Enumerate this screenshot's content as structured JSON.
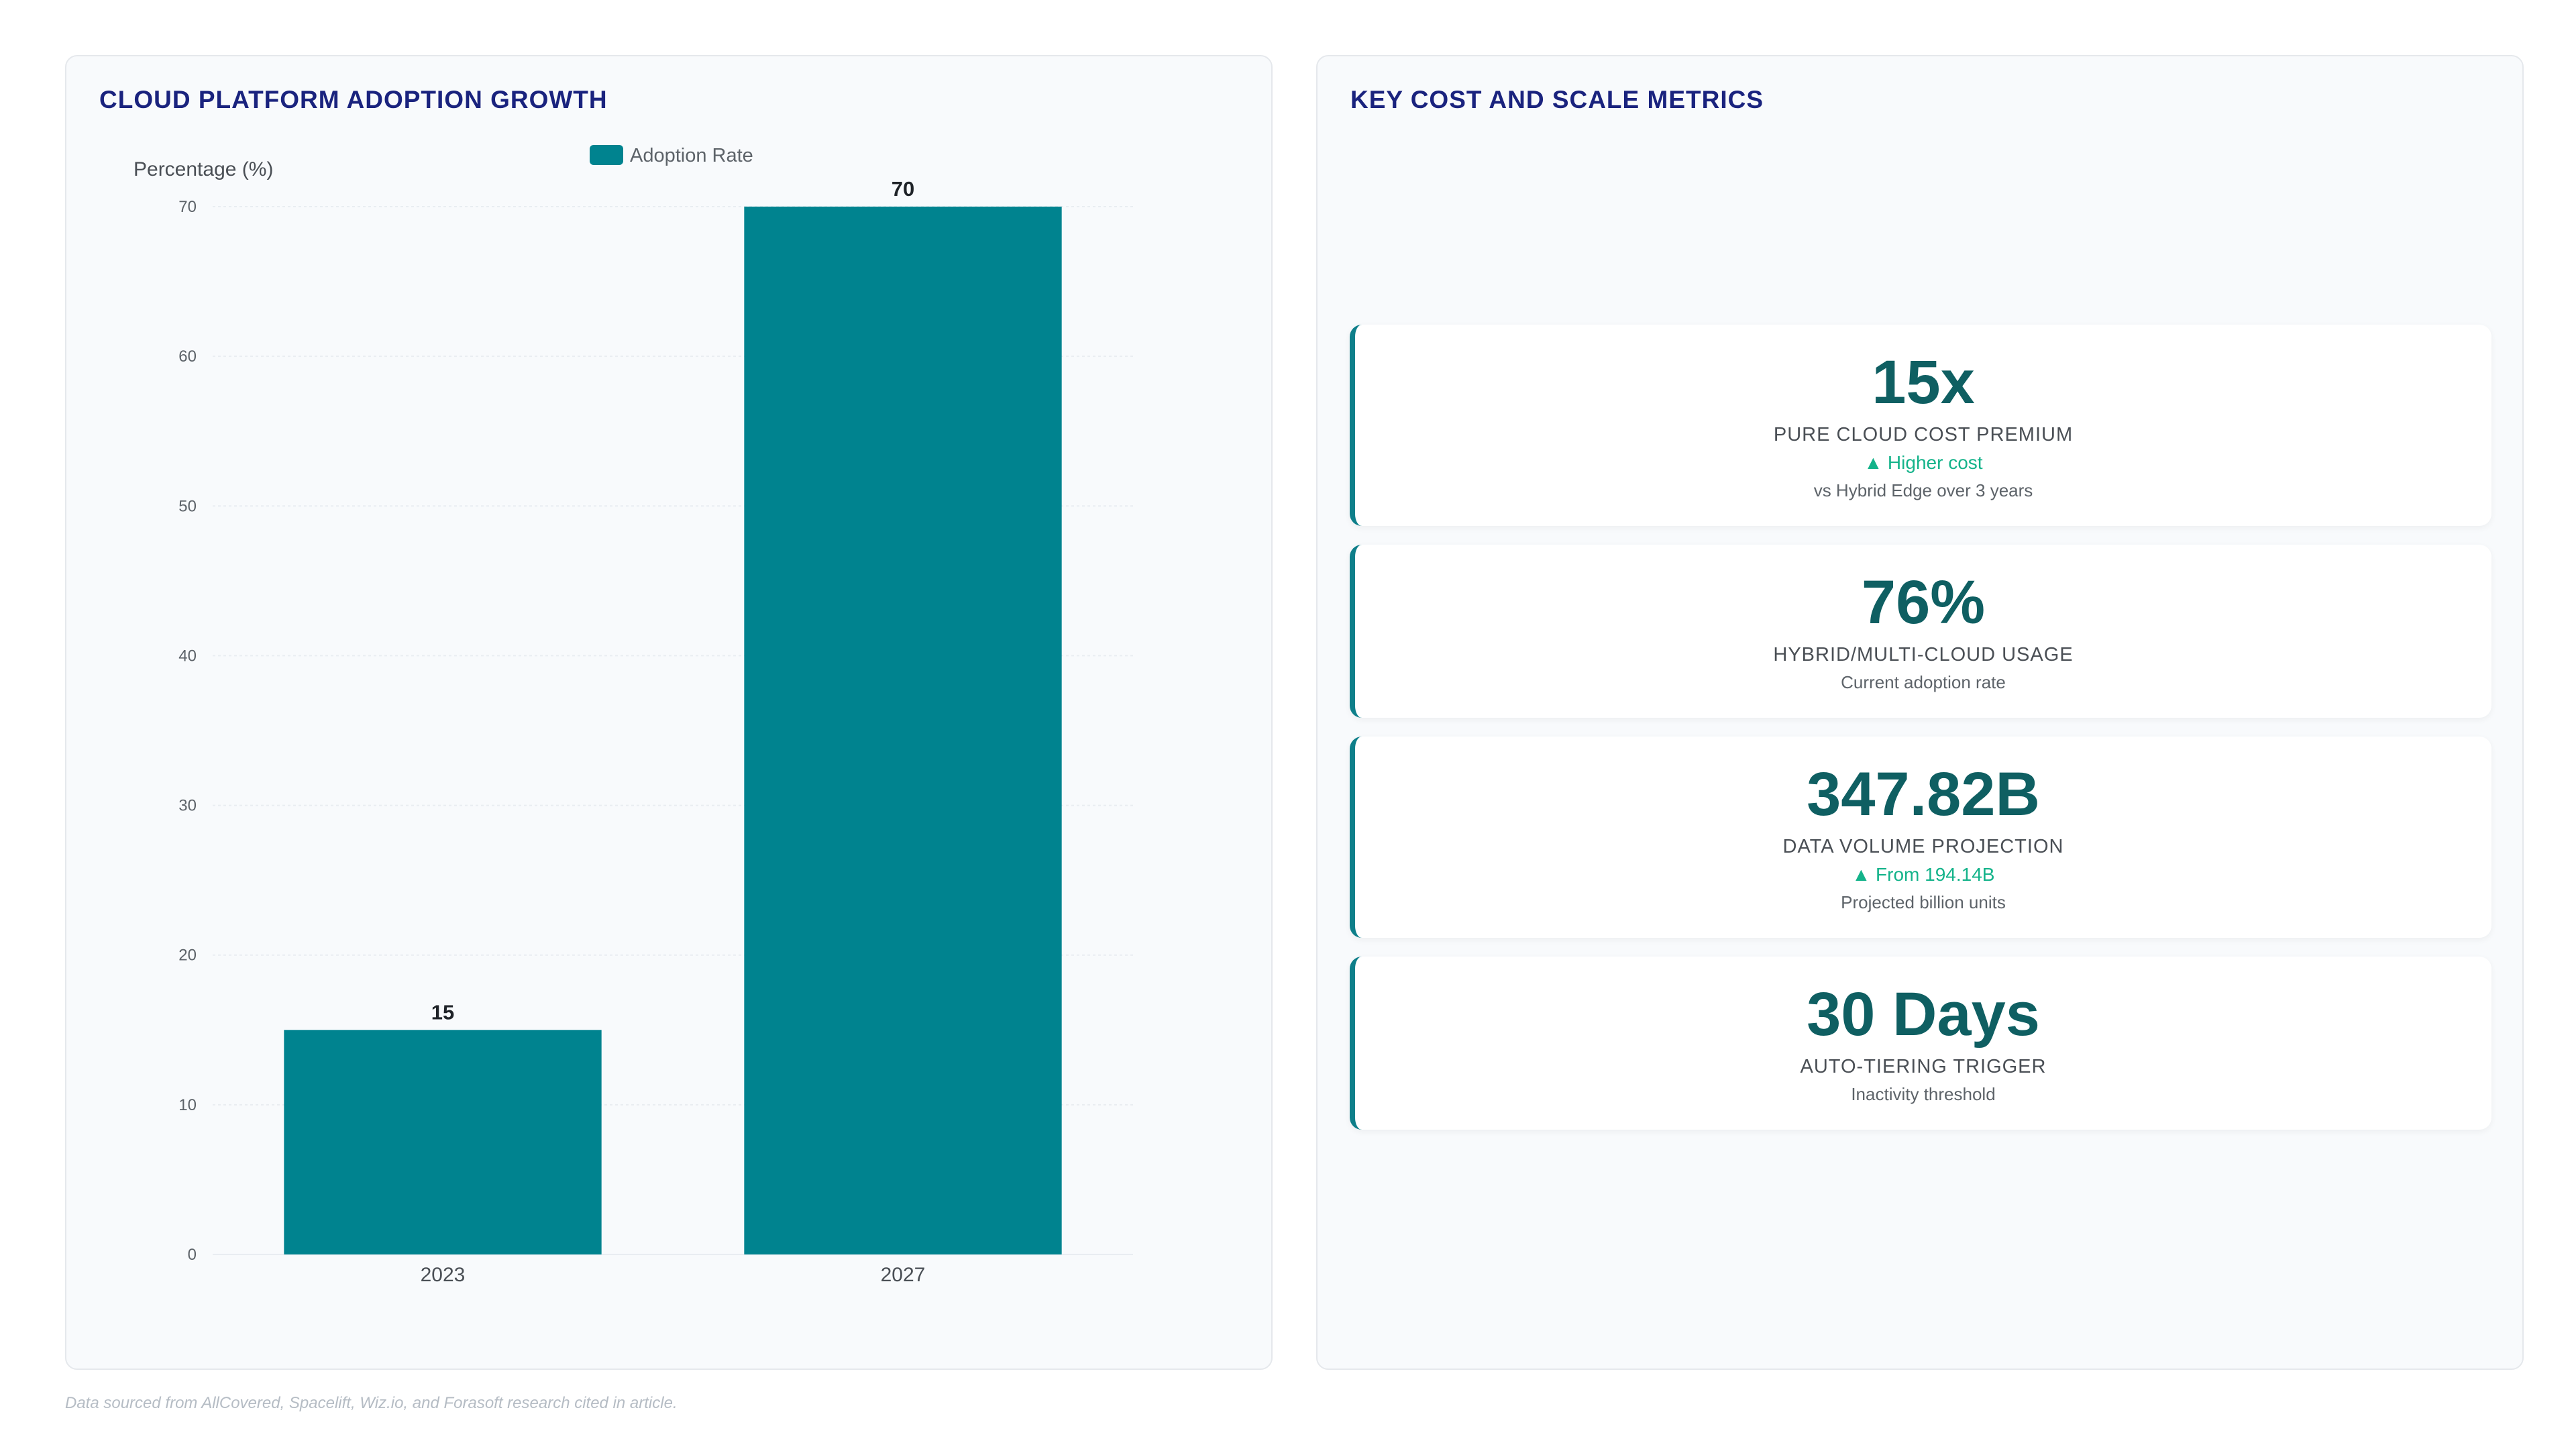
{
  "chart_panel": {
    "title": "CLOUD PLATFORM ADOPTION GROWTH"
  },
  "chart_data": {
    "type": "bar",
    "categories": [
      "2023",
      "2027"
    ],
    "series": [
      {
        "name": "Adoption Rate",
        "values": [
          15,
          70
        ]
      }
    ],
    "ylabel": "Percentage (%)",
    "xlabel": "",
    "ylim": [
      0,
      70
    ],
    "yticks": [
      0,
      10,
      20,
      30,
      40,
      50,
      60,
      70
    ],
    "grid": true,
    "legend": "top-center",
    "bar_color": "#00838f",
    "data_labels": true
  },
  "metrics_panel": {
    "title": "KEY COST AND SCALE METRICS",
    "cards": [
      {
        "value": "15x",
        "label": "PURE CLOUD COST PREMIUM",
        "trend": "▲ Higher cost",
        "note": "vs Hybrid Edge over 3 years"
      },
      {
        "value": "76%",
        "label": "HYBRID/MULTI-CLOUD USAGE",
        "trend": "",
        "note": "Current adoption rate"
      },
      {
        "value": "347.82B",
        "label": "DATA VOLUME PROJECTION",
        "trend": "▲ From 194.14B",
        "note": "Projected billion units"
      },
      {
        "value": "30 Days",
        "label": "AUTO-TIERING TRIGGER",
        "trend": "",
        "note": "Inactivity threshold"
      }
    ]
  },
  "footnote": "Data sourced from AllCovered, Spacelift, Wiz.io, and Forasoft research cited in article.",
  "colors": {
    "accent": "#00838f",
    "value_text": "#0f5f62",
    "trend_up": "#14b38a",
    "title": "#1a237e"
  }
}
